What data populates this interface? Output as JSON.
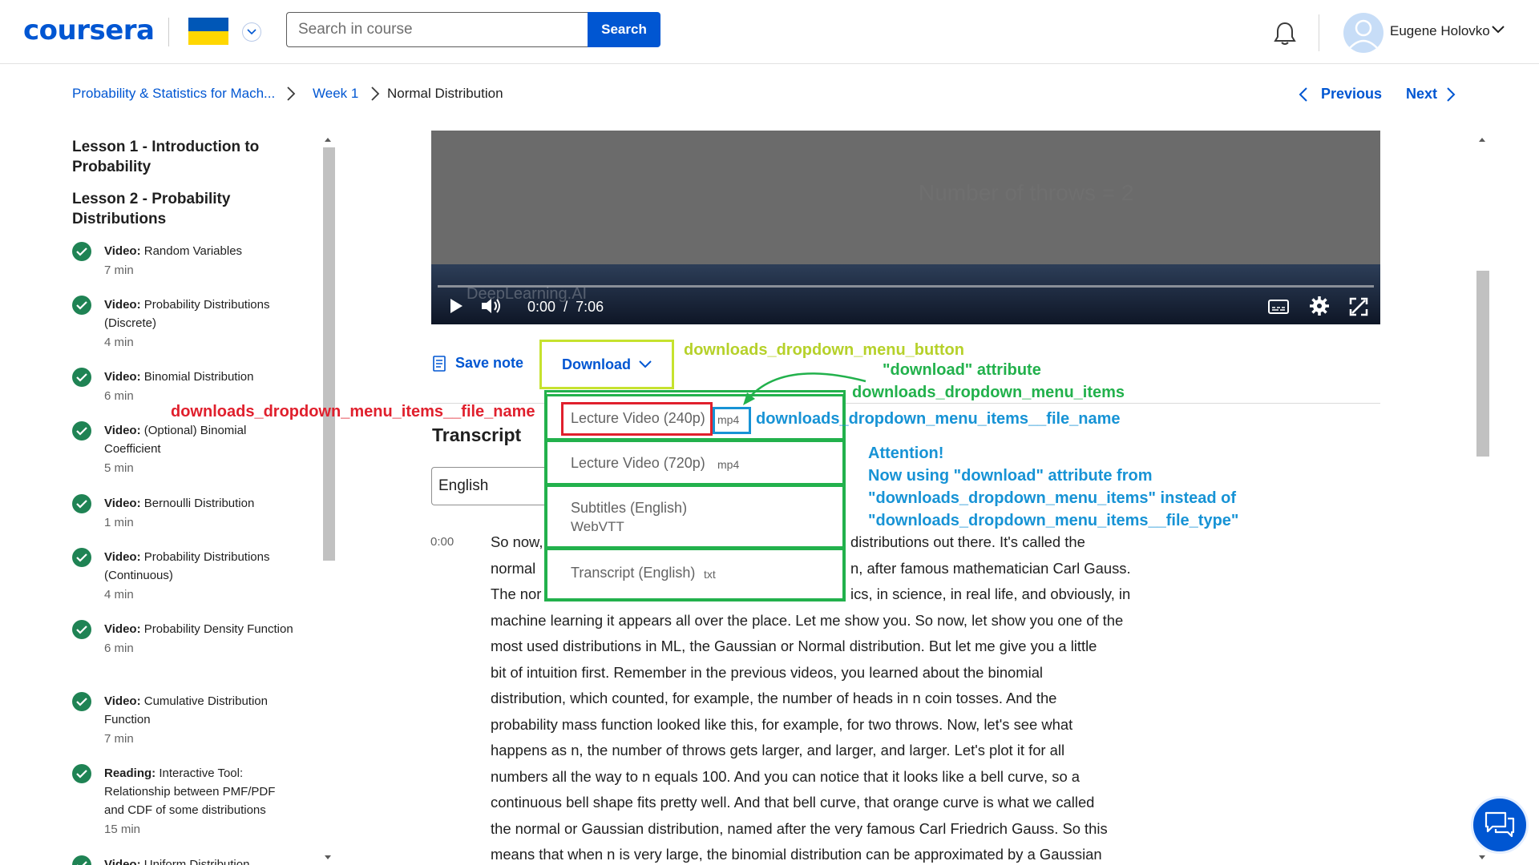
{
  "header": {
    "logo": "coursera",
    "search_placeholder": "Search in course",
    "search_button": "Search",
    "user_name": "Eugene Holovko"
  },
  "breadcrumb": {
    "course": "Probability & Statistics for Mach...",
    "week": "Week 1",
    "current": "Normal Distribution",
    "previous": "Previous",
    "next": "Next"
  },
  "sidebar": {
    "lessons": [
      "Lesson 1 - Introduction to Probability",
      "Lesson 2 - Probability Distributions"
    ],
    "items": [
      {
        "type": "Video:",
        "title": "Random Variables",
        "duration": "7 min"
      },
      {
        "type": "Video:",
        "title": "Probability Distributions (Discrete)",
        "duration": "4 min"
      },
      {
        "type": "Video:",
        "title": "Binomial Distribution",
        "duration": "6 min"
      },
      {
        "type": "Video:",
        "title": "(Optional) Binomial Coefficient",
        "duration": "5 min"
      },
      {
        "type": "Video:",
        "title": "Bernoulli Distribution",
        "duration": "1 min"
      },
      {
        "type": "Video:",
        "title": "Probability Distributions (Continuous)",
        "duration": "4 min"
      },
      {
        "type": "Video:",
        "title": "Probability Density Function",
        "duration": "6 min"
      },
      {
        "type": "Video:",
        "title": "Cumulative Distribution Function",
        "duration": "7 min"
      },
      {
        "type": "Reading:",
        "title": "Interactive Tool: Relationship between PMF/PDF and CDF of some distributions",
        "duration": "15 min"
      },
      {
        "type": "Video:",
        "title": "Uniform Distribution",
        "duration": ""
      }
    ]
  },
  "video": {
    "overlay_text": "Number of throws = 2",
    "watermark": "DeepLearning.AI",
    "current_time": "0:00",
    "separator": "/",
    "total_time": "7:06"
  },
  "actions": {
    "save_note": "Save note",
    "download": "Download"
  },
  "download_menu": [
    {
      "label": "Lecture Video (240p)",
      "type": "mp4"
    },
    {
      "label": "Lecture Video (720p)",
      "type": "mp4"
    },
    {
      "label": "Subtitles (English)",
      "type": "WebVTT"
    },
    {
      "label": "Transcript (English)",
      "type": "txt"
    }
  ],
  "transcript": {
    "title": "Transcript",
    "language": "English",
    "timestamp": "0:00",
    "lines": [
      "So now,",
      "normal",
      "The nor",
      "machine learning it appears all over the place. Let me show you. So now, let show you one of the",
      "most used distributions in ML, the Gaussian or Normal distribution. But let me give you a little",
      "bit of intuition first. Remember in the previous videos, you learned about the binomial",
      "distribution, which counted, for example, the number of heads in n coin tosses. And the",
      "probability mass function looked like this, for example, for two throws. Now, let's see what",
      "happens as n, the number of throws gets larger, and larger, and larger. Let's plot it for all",
      "numbers all the way to n equals 100. And you can notice that it looks like a bell curve, so a",
      "continuous bell shape fits pretty well. And that bell curve, that orange curve is what we called",
      "the normal or Gaussian distribution, named after the very famous Carl Friedrich Gauss. So this",
      "means that when n is very large, the binomial distribution can be approximated by a Gaussian"
    ],
    "right_fragments": [
      "distributions out there. It's called the",
      "n, after famous mathematician Carl Gauss.",
      "ics, in science, in real life, and obviously, in"
    ]
  },
  "annotations": {
    "button": "downloads_dropdown_menu_button",
    "download_attr": "\"download\" attribute",
    "items": "downloads_dropdown_menu_items",
    "file_name_left": "downloads_dropdown_menu_items__file_name",
    "file_name_right": "downloads_dropdown_menu_items__file_name",
    "attention_lines": [
      "Attention!",
      "Now using \"download\" attribute from",
      "\"downloads_dropdown_menu_items\" instead of",
      "\"downloads_dropdown_menu_items__file_type\""
    ]
  }
}
